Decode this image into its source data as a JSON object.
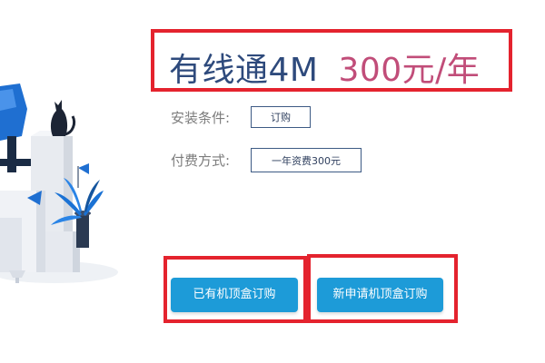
{
  "title": {
    "product": "有线通4M",
    "price": "300元/年"
  },
  "install_condition": {
    "label": "安装条件:",
    "option": "订购"
  },
  "payment_method": {
    "label": "付费方式:",
    "option": "一年资费300元"
  },
  "actions": {
    "have_box": "已有机顶盒订购",
    "new_box": "新申请机顶盒订购"
  },
  "colors": {
    "highlight_frame": "#e4232e",
    "title_product": "#2e4a7c",
    "title_price": "#c14d79",
    "button": "#1d9bd8",
    "option_border": "#3d5a84"
  }
}
